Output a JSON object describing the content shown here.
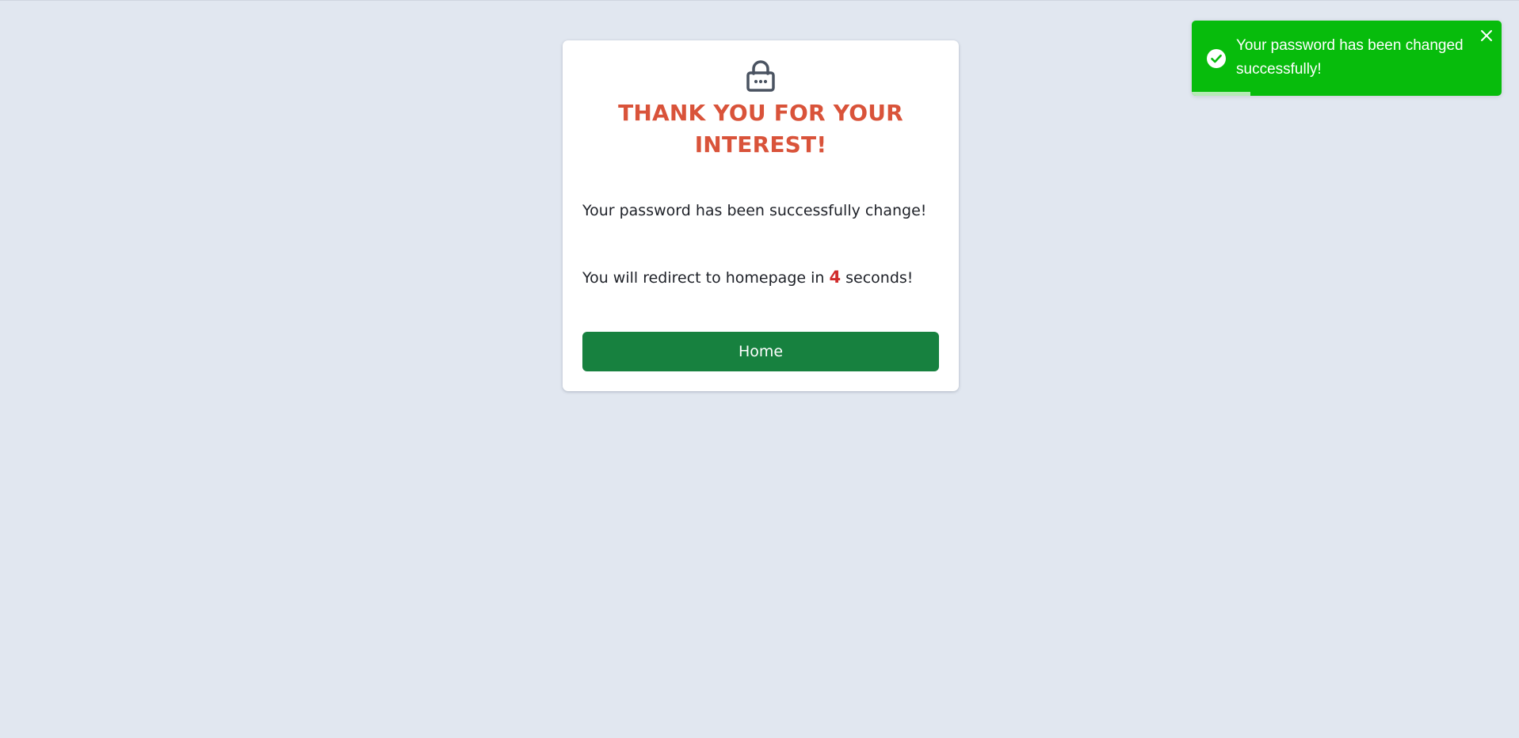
{
  "card": {
    "icon": "lock-icon",
    "title": "THANK YOU FOR YOUR INTEREST!",
    "message": "Your password has been successfully change!",
    "redirect_prefix": "You will redirect to homepage in ",
    "redirect_seconds": "4",
    "redirect_suffix": " seconds!",
    "home_button_label": "Home"
  },
  "toast": {
    "icon": "check-circle-icon",
    "message": "Your password has been changed successfully!",
    "close_icon": "close-icon",
    "progress_remaining": 0.19
  },
  "colors": {
    "page_background": "#e1e7f0",
    "title": "#d9533a",
    "countdown": "#d12b2b",
    "home_button": "#17813f",
    "toast_background": "#07bc0c",
    "icon": "#4a5361"
  }
}
